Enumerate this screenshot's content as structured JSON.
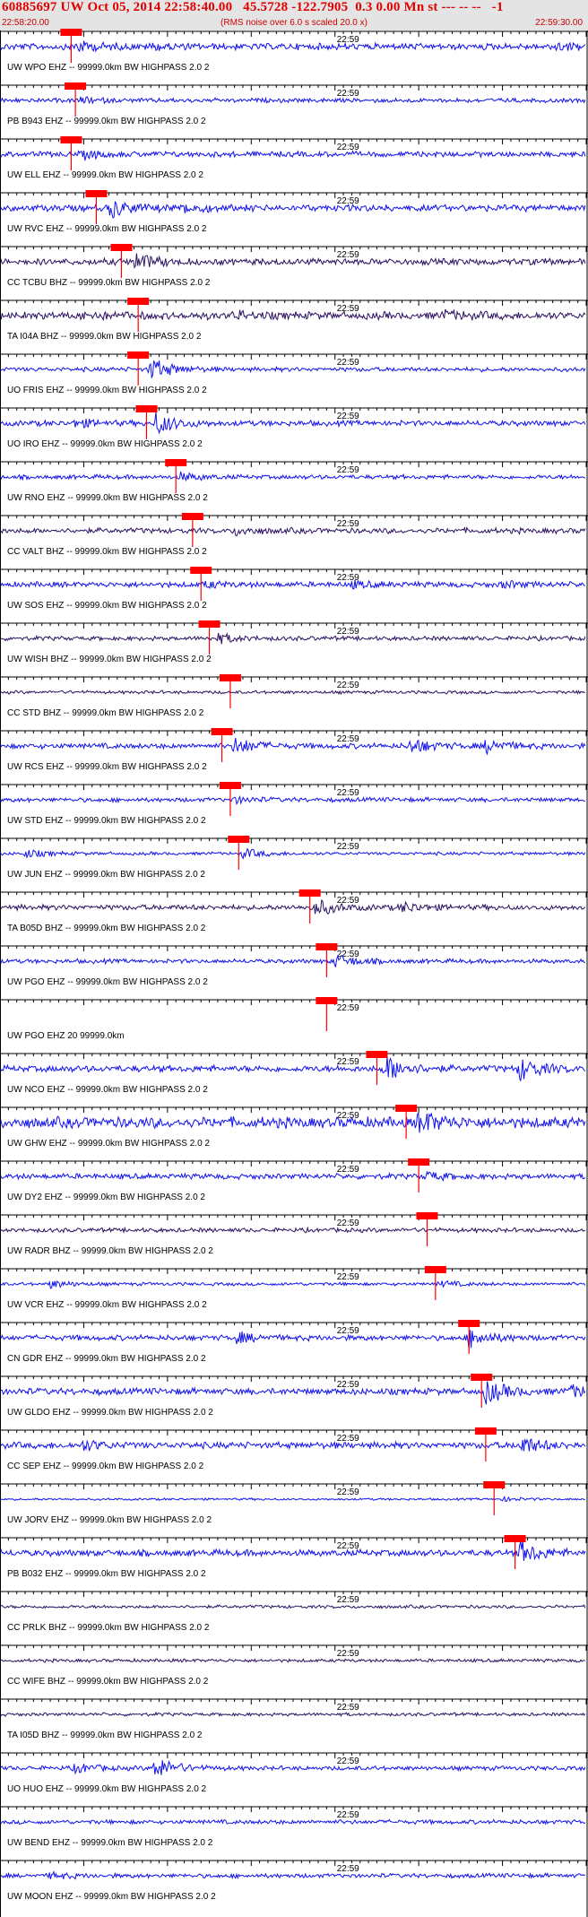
{
  "header": {
    "title": "60885697 UW Oct 05, 2014 22:58:40.00   45.5728 -122.7905  0.3 0.00 Mn st --- -- --   -1",
    "time_start": "22:58:20.00",
    "time_end": "22:59:30.00",
    "subtitle": "(RMS noise over 6.0 s scaled 20.0 x)"
  },
  "colors": {
    "title": "#e00000",
    "trace_blue": "#1010ee",
    "trace_purple": "#2a1060",
    "pick": "#ff0000",
    "axis": "#000000",
    "header_bg": "#e4e4e4"
  },
  "chart_data": {
    "type": "seismogram",
    "time_axis": {
      "start": "22:58:20.00",
      "end": "22:59:30.00",
      "center_label": "22:59",
      "center_label_seconds": 40
    },
    "traces": [
      {
        "label": "UW WPO EHZ -- 99999.0km BW  HIGHPASS  2.0  2",
        "color": "#1010ee",
        "pick": 8.5,
        "amp": 3.0,
        "events": [
          [
            9,
            6
          ],
          [
            18,
            3
          ],
          [
            66,
            4
          ]
        ]
      },
      {
        "label": "PB B943 EHZ -- 99999.0km BW  HIGHPASS  2.0  2",
        "color": "#1010ee",
        "pick": 9.0,
        "amp": 2.0,
        "events": [
          [
            9.5,
            3
          ]
        ]
      },
      {
        "label": "UW ELL EHZ -- 99999.0km BW  HIGHPASS  2.0  2",
        "color": "#1010ee",
        "pick": 8.5,
        "amp": 2.5,
        "events": [
          [
            10,
            4
          ]
        ]
      },
      {
        "label": "UW RVC EHZ -- 99999.0km BW  HIGHPASS  2.0  2",
        "color": "#1010ee",
        "pick": 11.5,
        "amp": 3.0,
        "events": [
          [
            13,
            10
          ],
          [
            22,
            5
          ]
        ]
      },
      {
        "label": "CC TCBU BHZ -- 99999.0km BW  HIGHPASS  2.0  2",
        "color": "#2a1060",
        "pick": 14.5,
        "amp": 3.0,
        "events": [
          [
            16,
            9
          ]
        ]
      },
      {
        "label": "TA I04A BHZ -- 99999.0km BW  HIGHPASS  2.0  2",
        "color": "#2a1060",
        "pick": 16.5,
        "amp": 3.5,
        "events": [
          [
            10,
            3
          ],
          [
            28,
            3
          ],
          [
            53,
            4
          ]
        ]
      },
      {
        "label": "UO FRIS EHZ -- 99999.0km BW  HIGHPASS  2.0  2",
        "color": "#1010ee",
        "pick": 16.5,
        "amp": 2.0,
        "events": [
          [
            18,
            12
          ]
        ]
      },
      {
        "label": "UO IRO EHZ -- 99999.0km BW  HIGHPASS  2.0  2",
        "color": "#1010ee",
        "pick": 17.5,
        "amp": 2.5,
        "events": [
          [
            18.5,
            12
          ],
          [
            9,
            4
          ]
        ]
      },
      {
        "label": "UW RNO EHZ -- 99999.0km BW  HIGHPASS  2.0  2",
        "color": "#1010ee",
        "pick": 21.0,
        "amp": 2.0,
        "events": [
          [
            21.5,
            4
          ]
        ]
      },
      {
        "label": "CC VALT BHZ -- 99999.0km BW  HIGHPASS  2.0  2",
        "color": "#2a1060",
        "pick": 23.0,
        "amp": 2.5,
        "events": [
          [
            28,
            4
          ]
        ]
      },
      {
        "label": "UW SOS EHZ -- 99999.0km BW  HIGHPASS  2.0  2",
        "color": "#1010ee",
        "pick": 24.0,
        "amp": 2.5,
        "events": [
          [
            24.5,
            3
          ],
          [
            42,
            3
          ],
          [
            60,
            3
          ]
        ]
      },
      {
        "label": "UW WISH BHZ -- 99999.0km BW  HIGHPASS  2.0  2",
        "color": "#2a1060",
        "pick": 25.0,
        "amp": 2.0,
        "events": [
          [
            26,
            5
          ]
        ]
      },
      {
        "label": "CC STD BHZ -- 99999.0km BW  HIGHPASS  2.0  2",
        "color": "#2a1060",
        "pick": 27.5,
        "amp": 1.5,
        "events": []
      },
      {
        "label": "UW RCS EHZ -- 99999.0km BW  HIGHPASS  2.0  2",
        "color": "#1010ee",
        "pick": 26.5,
        "amp": 2.5,
        "events": [
          [
            28,
            9
          ],
          [
            49,
            8
          ],
          [
            58,
            7
          ]
        ]
      },
      {
        "label": "UW STD EHZ -- 99999.0km BW  HIGHPASS  2.0  2",
        "color": "#1010ee",
        "pick": 27.5,
        "amp": 2.0,
        "events": [
          [
            28,
            3
          ]
        ]
      },
      {
        "label": "UW JUN EHZ -- 99999.0km BW  HIGHPASS  2.0  2",
        "color": "#1010ee",
        "pick": 28.5,
        "amp": 1.5,
        "events": [
          [
            3,
            4
          ],
          [
            29,
            5
          ]
        ]
      },
      {
        "label": "TA B05D BHZ -- 99999.0km BW  HIGHPASS  2.0  2",
        "color": "#2a1060",
        "pick": 37.0,
        "amp": 2.5,
        "events": [
          [
            37.5,
            9
          ],
          [
            48,
            5
          ]
        ]
      },
      {
        "label": "UW PGO EHZ -- 99999.0km BW  HIGHPASS  2.0  2",
        "color": "#1010ee",
        "pick": 39.0,
        "amp": 2.0,
        "events": [
          [
            40,
            7
          ]
        ]
      },
      {
        "label": "UW PGO EHZ 20 99999.0km",
        "color": "#1010ee",
        "pick": 39.0,
        "amp": 0.0,
        "events": []
      },
      {
        "label": "UW NCO EHZ -- 99999.0km BW  HIGHPASS  2.0  2",
        "color": "#1010ee",
        "pick": 45.0,
        "amp": 3.0,
        "events": [
          [
            46,
            14
          ],
          [
            62,
            12
          ]
        ]
      },
      {
        "label": "UW GHW EHZ -- 99999.0km BW  HIGHPASS  2.0  2",
        "color": "#1010ee",
        "pick": 48.5,
        "amp": 5.0,
        "events": [
          [
            50,
            11
          ]
        ]
      },
      {
        "label": "UW DY2 EHZ -- 99999.0km BW  HIGHPASS  2.0  2",
        "color": "#1010ee",
        "pick": 50.0,
        "amp": 2.5,
        "events": [
          [
            51,
            4
          ]
        ]
      },
      {
        "label": "UW RADR BHZ -- 99999.0km BW  HIGHPASS  2.0  2",
        "color": "#2a1060",
        "pick": 51.0,
        "amp": 2.0,
        "events": []
      },
      {
        "label": "UW VCR EHZ -- 99999.0km BW  HIGHPASS  2.0  2",
        "color": "#1010ee",
        "pick": 52.0,
        "amp": 1.5,
        "events": [
          [
            6,
            4
          ],
          [
            52.5,
            3
          ]
        ]
      },
      {
        "label": "CN GDR EHZ -- 99999.0km BW  HIGHPASS  2.0  2",
        "color": "#1010ee",
        "pick": 56.0,
        "amp": 2.5,
        "events": [
          [
            28,
            6
          ],
          [
            56,
            10
          ]
        ]
      },
      {
        "label": "UW GLDO EHZ -- 99999.0km BW  HIGHPASS  2.0  2",
        "color": "#1010ee",
        "pick": 57.5,
        "amp": 3.0,
        "events": [
          [
            58,
            12
          ],
          [
            68,
            6
          ]
        ]
      },
      {
        "label": "CC SEP EHZ -- 99999.0km BW  HIGHPASS  2.0  2",
        "color": "#1010ee",
        "pick": 58.0,
        "amp": 3.0,
        "events": [
          [
            10,
            5
          ],
          [
            62,
            10
          ]
        ]
      },
      {
        "label": "UW JORV EHZ -- 99999.0km BW  HIGHPASS  2.0  2",
        "color": "#1010ee",
        "pick": 59.0,
        "amp": 1.0,
        "events": [
          [
            60,
            2
          ]
        ]
      },
      {
        "label": "PB B032 EHZ -- 99999.0km BW  HIGHPASS  2.0  2",
        "color": "#1010ee",
        "pick": 61.5,
        "amp": 3.0,
        "events": [
          [
            62,
            12
          ]
        ]
      },
      {
        "label": "CC PRLK BHZ -- 99999.0km BW  HIGHPASS  2.0  2",
        "color": "#2a1060",
        "pick": null,
        "amp": 1.5,
        "events": []
      },
      {
        "label": "CC WIFE BHZ -- 99999.0km BW  HIGHPASS  2.0  2",
        "color": "#2a1060",
        "pick": null,
        "amp": 1.5,
        "events": []
      },
      {
        "label": "TA I05D BHZ -- 99999.0km BW  HIGHPASS  2.0  2",
        "color": "#2a1060",
        "pick": null,
        "amp": 1.5,
        "events": []
      },
      {
        "label": "UO HUO EHZ -- 99999.0km BW  HIGHPASS  2.0  2",
        "color": "#1010ee",
        "pick": null,
        "amp": 2.0,
        "events": [
          [
            9,
            5
          ],
          [
            18.5,
            12
          ]
        ]
      },
      {
        "label": "UW BEND EHZ -- 99999.0km BW  HIGHPASS  2.0  2",
        "color": "#1010ee",
        "pick": null,
        "amp": 2.0,
        "events": []
      },
      {
        "label": "UW MOON EHZ -- 99999.0km BW  HIGHPASS  2.0  2",
        "color": "#1010ee",
        "pick": null,
        "amp": 2.0,
        "events": [
          [
            6,
            3
          ]
        ]
      }
    ]
  }
}
